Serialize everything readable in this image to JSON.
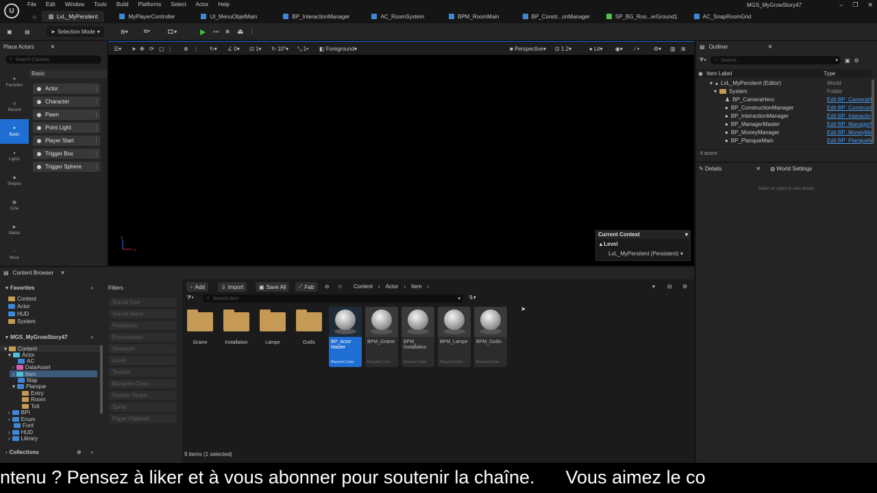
{
  "menu": [
    "File",
    "Edit",
    "Window",
    "Tools",
    "Build",
    "Platforms",
    "Select",
    "Actor",
    "Help"
  ],
  "project_name": "MGS_MyGrowStory47",
  "tabs": [
    {
      "label": "LvL_MyPersitent",
      "active": true
    },
    {
      "label": "MyPlayerController"
    },
    {
      "label": "UI_MenuObjetMain"
    },
    {
      "label": "BP_InteractionManager"
    },
    {
      "label": "AC_RoomSystem"
    },
    {
      "label": "BPM_RoomMain"
    },
    {
      "label": "BP_Constr...onManager"
    },
    {
      "label": "SP_BG_Roo...erGround1"
    },
    {
      "label": "AC_SnapRoomGrid"
    }
  ],
  "toolbar": {
    "selection_mode": "Selection Mode"
  },
  "place_actors": {
    "title": "Place Actors",
    "search_placeholder": "Search Classes",
    "section": "Basic",
    "categories": [
      "Favorites",
      "Recent",
      "Basic",
      "Lights",
      "Shapes",
      "Cine",
      "Media",
      "More"
    ],
    "items": [
      "Actor",
      "Character",
      "Pawn",
      "Point Light",
      "Player Start",
      "Trigger Box",
      "Trigger Sphere"
    ]
  },
  "viewport": {
    "snap_angle": "0",
    "snap_grid": "1",
    "snap_rot": "10°",
    "snap_scale": "1",
    "layer": "Foreground",
    "perspective": "Perspective",
    "speed": "1.2",
    "lit": "Lit",
    "context_title": "Current Context",
    "context_level_label": "Level",
    "context_level_value": "LvL_MyPersitent (Persistent)"
  },
  "outliner": {
    "title": "Outliner",
    "search_placeholder": "Search...",
    "col_label": "Item Label",
    "col_type": "Type",
    "rows": [
      {
        "label": "LvL_MyPersitent (Editor)",
        "type": "World"
      },
      {
        "label": "System",
        "type": "Folder"
      },
      {
        "label": "BP_CameraHero",
        "type": "Edit BP_CameraH"
      },
      {
        "label": "BP_ConstructionManager",
        "type": "Edit BP_Construct"
      },
      {
        "label": "BP_InteractionManager",
        "type": "Edit BP_Interactio"
      },
      {
        "label": "BP_ManagerMaster",
        "type": "Edit BP_ManagerM"
      },
      {
        "label": "BP_MoneyManager",
        "type": "Edit BP_MoneyMa"
      },
      {
        "label": "BP_PlanqueMain",
        "type": "Edit BP_PlanqueM"
      }
    ],
    "count": "8 actors"
  },
  "details": {
    "tab_details": "Details",
    "tab_world": "World Settings",
    "empty": "Select an object to view details."
  },
  "content_browser": {
    "title": "Content Browser",
    "favorites": "Favorites",
    "fav_items": [
      "Content",
      "Actor",
      "HUD",
      "System"
    ],
    "project": "MGS_MyGrowStory47",
    "tree": [
      "Content",
      "Actor",
      "AC",
      "DataAsset",
      "Item",
      "Map",
      "Planque",
      "Entry",
      "Room",
      "Toit",
      "BPI",
      "Enum",
      "Font",
      "HUD",
      "Library"
    ],
    "collections": "Collections",
    "filters_title": "Filters",
    "filters": [
      "Sound Cue",
      "Sound Wave",
      "Redirector",
      "Enumeration",
      "Structure",
      "Level",
      "Texture",
      "Blueprint Class",
      "Render Target",
      "Sprite",
      "Paper Flipbook"
    ],
    "add": "Add",
    "import": "Import",
    "save_all": "Save All",
    "fab": "Fab",
    "breadcrumb": [
      "Content",
      "Actor",
      "Item"
    ],
    "search_placeholder": "Search Item",
    "folders": [
      "Graine",
      "Installation",
      "Lampe",
      "Outils"
    ],
    "blueprints": [
      {
        "name": "BP_Actor Master",
        "class": "Blueprint Class",
        "selected": true
      },
      {
        "name": "BPM_Graine",
        "class": "Blueprint Class"
      },
      {
        "name": "BPM_ Installation",
        "class": "Blueprint Class"
      },
      {
        "name": "BPM_Lampe",
        "class": "Blueprint Class"
      },
      {
        "name": "BPM_Outils",
        "class": "Blueprint Class"
      }
    ],
    "status": "9 items (1 selected)"
  },
  "subtitle": "ntenu ? Pensez à liker et à vous abonner pour soutenir la chaîne.      Vous aimez le co",
  "colors": {
    "accent": "#1f6ed4",
    "folder": "#c49a55",
    "link": "#4a9ef5"
  }
}
